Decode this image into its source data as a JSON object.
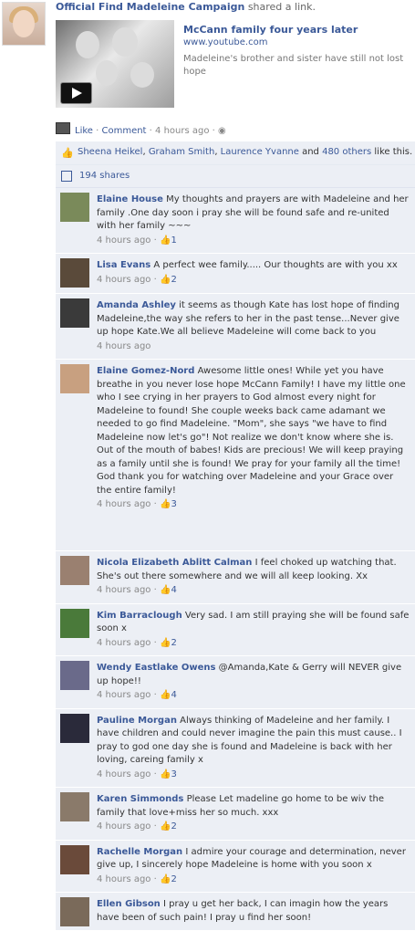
{
  "post": {
    "page_name": "Official Find Madeleine Campaign",
    "action": "shared a link.",
    "link": {
      "title": "McCann family four years later",
      "url": "www.youtube.com",
      "description": "Madeleine's brother and sister have still not lost hope"
    },
    "actions": {
      "like": "Like",
      "sep1": " · ",
      "comment": "Comment",
      "sep2": " · ",
      "time": "4 hours ago",
      "sep3": " · "
    },
    "likes": {
      "name1": "Sheena Heikel",
      "sep1": ", ",
      "name2": "Graham Smith",
      "sep2": ", ",
      "name3": "Laurence Yvanne",
      "and": " and ",
      "others": "480 others",
      "suffix": " like this."
    },
    "shares": "194 shares"
  },
  "comments": [
    {
      "name": "Elaine House",
      "text": "My thoughts and prayers are with Madeleine and her family .One day soon i pray she will be found safe and re-united with her family ~~~",
      "time": "4 hours ago",
      "likes": "1",
      "color": "#7a8a5a"
    },
    {
      "name": "Lisa Evans",
      "text": "A perfect wee family..... Our thoughts are with you xx",
      "time": "4 hours ago",
      "likes": "2",
      "color": "#5a4a3a"
    },
    {
      "name": "Amanda Ashley",
      "text": "it seems as though Kate has lost hope of finding Madeleine,the way she refers to her in the past tense...Never give up hope Kate.We all believe Madeleine will come back to you",
      "time": "4 hours ago",
      "likes": "",
      "color": "#3a3a3a"
    },
    {
      "name": "Elaine Gomez-Nord",
      "text": "Awesome little ones! While yet you have breathe in you never lose hope McCann Family! I have my little one who I see crying in her prayers to God almost every night for Madeleine to found! She couple weeks back came adamant we needed to go find Madeleine. \"Mom\", she says \"we have to find Madeleine now let's go\"! Not realize we don't know where she is. Out of the mouth of babes! Kids are precious! We will keep praying as a family until she is found! We pray for your family all the time! God thank you for watching over Madeleine and your Grace over the entire family!",
      "time": "4 hours ago",
      "likes": "3",
      "color": "#c8a080"
    },
    {
      "name": "Nicola Elizabeth Ablitt Calman",
      "text": "I feel choked up watching that. She's out there somewhere and we will all keep looking. Xx",
      "time": "4 hours ago",
      "likes": "4",
      "color": "#9a8070"
    },
    {
      "name": "Kim Barraclough",
      "text": "Very sad. I am still praying she will be found safe soon x",
      "time": "4 hours ago",
      "likes": "2",
      "color": "#4a7a3a"
    },
    {
      "name": "Wendy Eastlake Owens",
      "text": "@Amanda,Kate & Gerry will NEVER give up hope!!",
      "time": "4 hours ago",
      "likes": "4",
      "color": "#6a6a8a"
    },
    {
      "name": "Pauline Morgan",
      "text": "Always thinking of Madeleine and her family. I have children and could never imagine the pain this must cause.. I pray to god one day she is found and Madeleine is back with her loving, careing family x",
      "time": "4 hours ago",
      "likes": "3",
      "color": "#2a2a3a"
    },
    {
      "name": "Karen Simmonds",
      "text": "Please Let madeline go home to be wiv the family that love+miss her so much. xxx",
      "time": "4 hours ago",
      "likes": "2",
      "color": "#8a7a6a"
    },
    {
      "name": "Rachelle Morgan",
      "text": "I admire your courage and determination, never give up, I sincerely hope Madeleine is home with you soon x",
      "time": "4 hours ago",
      "likes": "2",
      "color": "#6a4a3a"
    },
    {
      "name": "Ellen Gibson",
      "text": "I pray u get her back, I can imagin how the years have been of such pain! I pray u find her soon!",
      "time": "",
      "likes": "",
      "color": "#7a6a5a"
    }
  ]
}
